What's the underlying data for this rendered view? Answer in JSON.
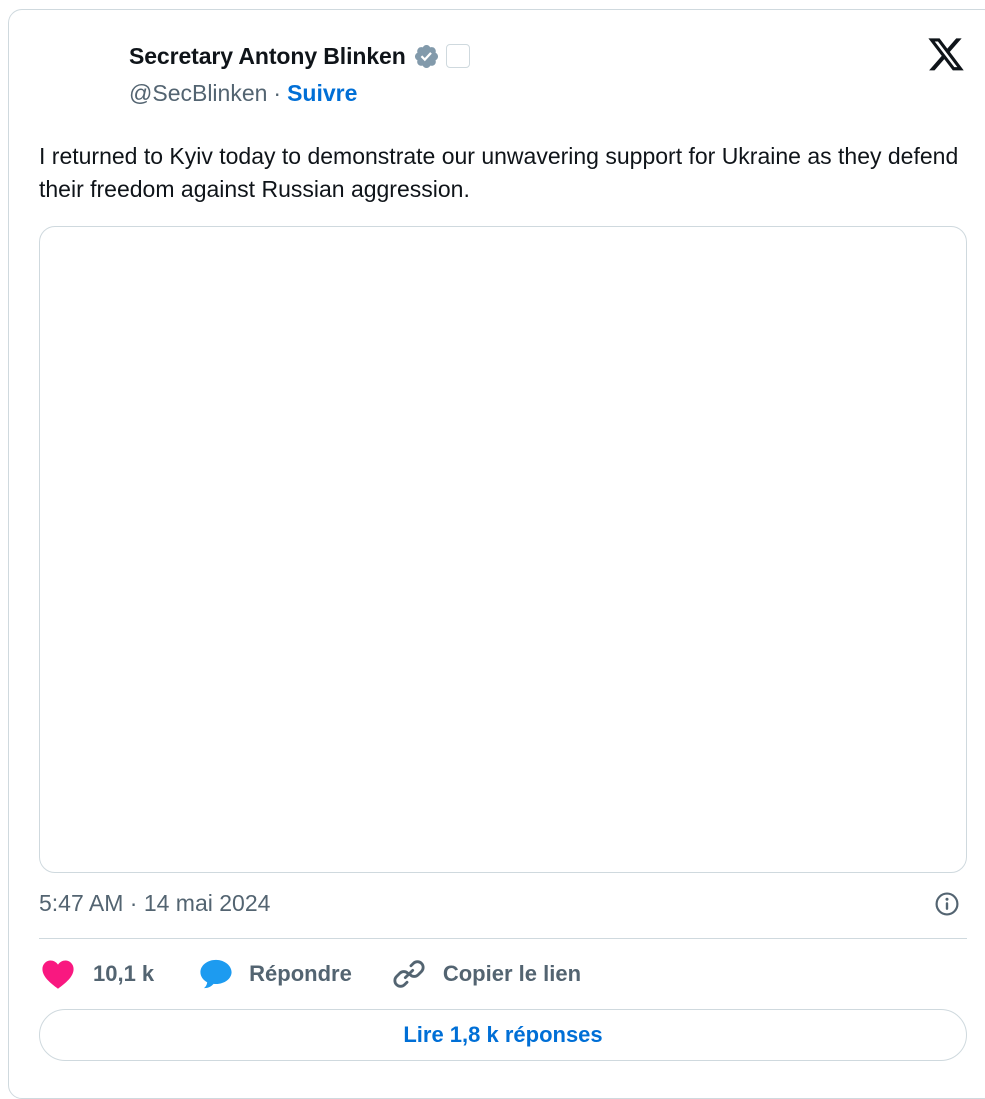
{
  "author": {
    "display_name": "Secretary Antony Blinken",
    "handle": "@SecBlinken",
    "separator": "·",
    "follow_label": "Suivre"
  },
  "tweet": {
    "text": "I returned to Kyiv today to demonstrate our unwavering support for Ukraine as they defend their freedom against Russian aggression.",
    "timestamp": "5:47 AM · 14 mai 2024"
  },
  "actions": {
    "like_count": "10,1 k",
    "reply_label": "Répondre",
    "copy_link_label": "Copier le lien"
  },
  "read_replies_label": "Lire 1,8 k réponses",
  "colors": {
    "text_primary": "#0f1419",
    "text_secondary": "#536471",
    "link_blue": "#006fd6",
    "like_pink": "#f91880",
    "reply_blue": "#1d9bf0",
    "verified_gray": "#829aab",
    "border": "#cfd9de"
  },
  "icons": {
    "verified": "verified-badge-icon",
    "affiliation": "affiliation-badge-icon",
    "brand": "x-logo-icon",
    "info": "info-icon",
    "like": "heart-icon",
    "reply": "speech-bubble-icon",
    "copy_link": "link-icon"
  }
}
